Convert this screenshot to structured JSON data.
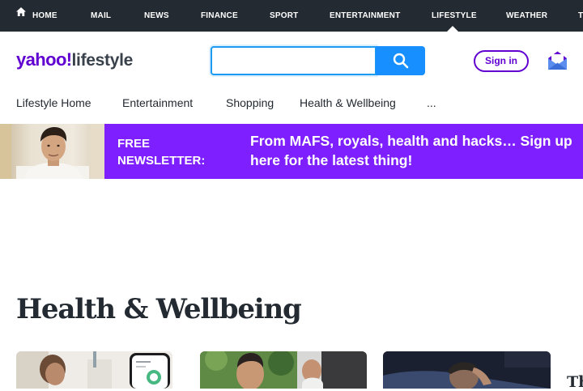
{
  "topnav": {
    "items": [
      "HOME",
      "MAIL",
      "NEWS",
      "FINANCE",
      "SPORT",
      "ENTERTAINMENT",
      "LIFESTYLE",
      "WEATHER",
      "T"
    ],
    "active": "LIFESTYLE"
  },
  "header": {
    "logo_brand": "yahoo!",
    "logo_product": "lifestyle",
    "search_placeholder": "",
    "signin_label": "Sign in"
  },
  "subnav": {
    "items": [
      "Lifestyle Home",
      "Entertainment",
      "Shopping",
      "Health & Wellbeing",
      "..."
    ]
  },
  "banner": {
    "label_line1": "FREE",
    "label_line2": "NEWSLETTER:",
    "text": "From MAFS, royals, health and hacks… Sign up here for the latest thing!"
  },
  "section": {
    "title": "Health & Wellbeing",
    "edge_text": "Th"
  },
  "icons": {
    "home": "home-icon",
    "search": "search-icon",
    "mail": "mail-icon"
  },
  "colors": {
    "topnav_bg": "#232a31",
    "brand_purple": "#6001d2",
    "banner_purple": "#7e1fff",
    "search_blue": "#188fff"
  }
}
